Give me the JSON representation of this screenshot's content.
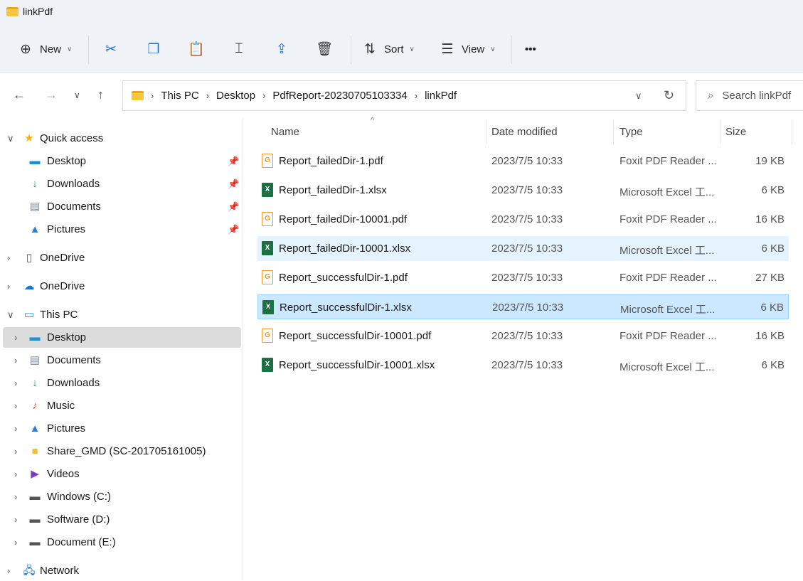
{
  "window": {
    "title": "linkPdf"
  },
  "toolbar": {
    "new_label": "New",
    "sort_label": "Sort",
    "view_label": "View",
    "more": "•••"
  },
  "address": {
    "crumbs": [
      "This PC",
      "Desktop",
      "PdfReport-20230705103334",
      "linkPdf"
    ],
    "search_placeholder": "Search linkPdf"
  },
  "sidebar": {
    "items": [
      {
        "label": "Quick access",
        "icon": "star-icon",
        "expand": "v",
        "level": 0
      },
      {
        "label": "Desktop",
        "icon": "desktop-icon",
        "pinned": true,
        "level": 1
      },
      {
        "label": "Downloads",
        "icon": "download-icon",
        "pinned": true,
        "level": 1
      },
      {
        "label": "Documents",
        "icon": "documents-icon",
        "pinned": true,
        "level": 1
      },
      {
        "label": "Pictures",
        "icon": "pictures-icon",
        "pinned": true,
        "level": 1
      },
      {
        "label": "OneDrive",
        "icon": "onedrive-file-icon",
        "expand": ">",
        "level": 0
      },
      {
        "label": "OneDrive",
        "icon": "onedrive-cloud-icon",
        "expand": ">",
        "level": 0
      },
      {
        "label": "This PC",
        "icon": "pc-icon",
        "expand": "v",
        "level": 0
      },
      {
        "label": "Desktop",
        "icon": "desktop-icon",
        "expand": ">",
        "level": 1,
        "selected": true
      },
      {
        "label": "Documents",
        "icon": "documents-icon",
        "expand": ">",
        "level": 1
      },
      {
        "label": "Downloads",
        "icon": "download-icon",
        "expand": ">",
        "level": 1
      },
      {
        "label": "Music",
        "icon": "music-icon",
        "expand": ">",
        "level": 1
      },
      {
        "label": "Pictures",
        "icon": "pictures-icon",
        "expand": ">",
        "level": 1
      },
      {
        "label": "Share_GMD (SC-201705161005)",
        "icon": "network-folder-icon",
        "expand": ">",
        "level": 1
      },
      {
        "label": "Videos",
        "icon": "videos-icon",
        "expand": ">",
        "level": 1
      },
      {
        "label": "Windows (C:)",
        "icon": "drive-icon",
        "expand": ">",
        "level": 1
      },
      {
        "label": "Software (D:)",
        "icon": "drive-icon",
        "expand": ">",
        "level": 1
      },
      {
        "label": "Document (E:)",
        "icon": "drive-icon",
        "expand": ">",
        "level": 1
      },
      {
        "label": "Network",
        "icon": "network-icon",
        "expand": ">",
        "level": 0
      }
    ]
  },
  "columns": {
    "name": "Name",
    "date": "Date modified",
    "type": "Type",
    "size": "Size"
  },
  "files": [
    {
      "name": "Report_failedDir-1.pdf",
      "date": "2023/7/5 10:33",
      "type": "Foxit PDF Reader ...",
      "size": "19 KB",
      "kind": "pdf"
    },
    {
      "name": "Report_failedDir-1.xlsx",
      "date": "2023/7/5 10:33",
      "type": "Microsoft Excel 工...",
      "size": "6 KB",
      "kind": "xls"
    },
    {
      "name": "Report_failedDir-10001.pdf",
      "date": "2023/7/5 10:33",
      "type": "Foxit PDF Reader ...",
      "size": "16 KB",
      "kind": "pdf"
    },
    {
      "name": "Report_failedDir-10001.xlsx",
      "date": "2023/7/5 10:33",
      "type": "Microsoft Excel 工...",
      "size": "6 KB",
      "kind": "xls",
      "state": "hov"
    },
    {
      "name": "Report_successfulDir-1.pdf",
      "date": "2023/7/5 10:33",
      "type": "Foxit PDF Reader ...",
      "size": "27 KB",
      "kind": "pdf"
    },
    {
      "name": "Report_successfulDir-1.xlsx",
      "date": "2023/7/5 10:33",
      "type": "Microsoft Excel 工...",
      "size": "6 KB",
      "kind": "xls",
      "state": "sel"
    },
    {
      "name": "Report_successfulDir-10001.pdf",
      "date": "2023/7/5 10:33",
      "type": "Foxit PDF Reader ...",
      "size": "16 KB",
      "kind": "pdf"
    },
    {
      "name": "Report_successfulDir-10001.xlsx",
      "date": "2023/7/5 10:33",
      "type": "Microsoft Excel 工...",
      "size": "6 KB",
      "kind": "xls"
    }
  ]
}
